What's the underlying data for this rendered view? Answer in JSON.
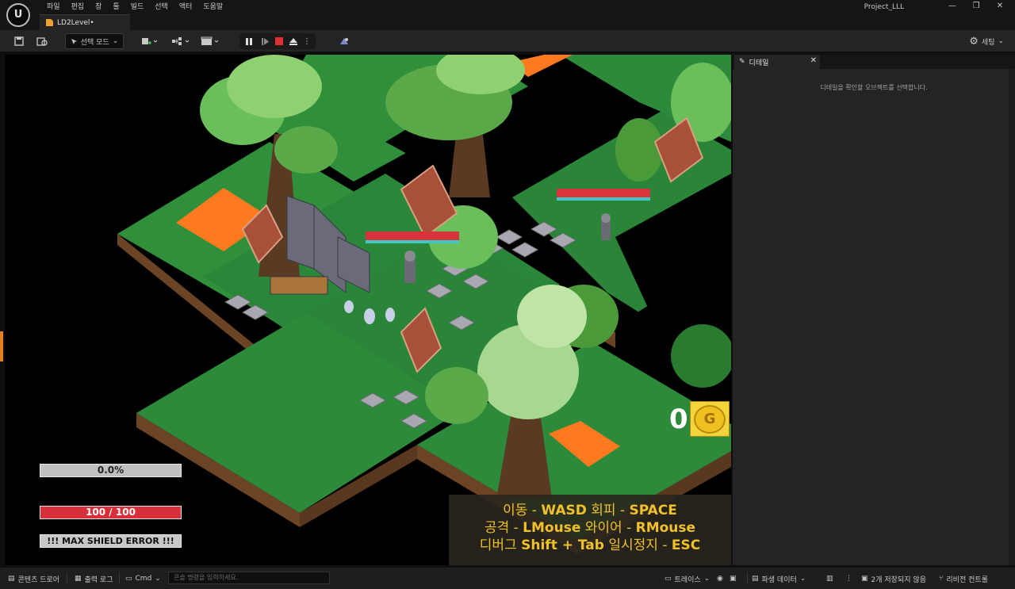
{
  "app": {
    "project_name": "Project_LLL",
    "logo_label": "U",
    "document_tab": "LD2Level•"
  },
  "menu": [
    "파일",
    "편집",
    "창",
    "툴",
    "빌드",
    "선택",
    "액터",
    "도움말"
  ],
  "toolbar": {
    "mode_select": "선택 모드",
    "settings_label": "세팅"
  },
  "hud": {
    "xp_text": "0.0%",
    "xp_fraction": 0.0,
    "hp_text": "100 / 100",
    "hp_fraction": 1.0,
    "shield_text": "!!! MAX SHIELD ERROR !!!",
    "gold_count": "0",
    "gold_coin_letter": "G"
  },
  "help": {
    "line1": [
      {
        "t": "이동 - ",
        "k": false
      },
      {
        "t": "WASD",
        "k": true
      },
      {
        "t": "  회피 - ",
        "k": false
      },
      {
        "t": "SPACE",
        "k": true
      }
    ],
    "line2": [
      {
        "t": "공격 - ",
        "k": false
      },
      {
        "t": "LMouse",
        "k": true
      },
      {
        "t": " 와이어 - ",
        "k": false
      },
      {
        "t": "RMouse",
        "k": true
      }
    ],
    "line3": [
      {
        "t": "디버그 ",
        "k": false
      },
      {
        "t": "Shift + Tab",
        "k": true
      },
      {
        "t": " 일시정지 - ",
        "k": false
      },
      {
        "t": "ESC",
        "k": true
      }
    ]
  },
  "details_panel": {
    "tab_label": "디테일",
    "hint": "디테일을 확인할 오브젝트를 선택합니다."
  },
  "statusbar": {
    "content_drawer": "콘텐츠 드로어",
    "output_log": "출력 로그",
    "cmd": "Cmd",
    "console_placeholder": "콘솔 명령을 입력하세요.",
    "trace": "트레이스",
    "derived_data": "파생 데이터",
    "unsaved": "2개 저장되지 않음",
    "revision_control": "리비전 컨트롤"
  },
  "colors": {
    "accent_orange": "#f08a2a",
    "hp_red": "#d8303a",
    "help_text": "#f2c028",
    "grass": "#2d8a3a"
  }
}
